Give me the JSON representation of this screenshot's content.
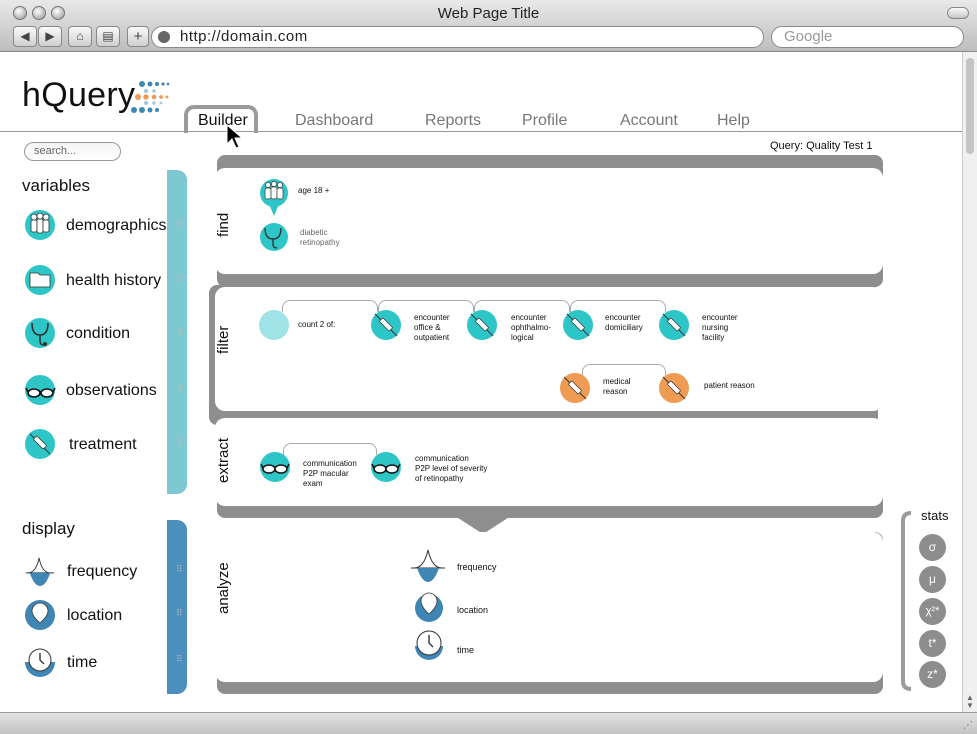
{
  "browser": {
    "title": "Web Page Title",
    "url": "http://domain.com",
    "search_placeholder": "Google"
  },
  "app": {
    "logo": "hQuery",
    "tabs": [
      "Builder",
      "Dashboard",
      "Reports",
      "Profile",
      "Account",
      "Help"
    ],
    "active_tab": "Builder",
    "search_placeholder": "search..."
  },
  "sidebar": {
    "variables_heading": "variables",
    "variables": [
      {
        "label": "demographics",
        "icon": "people-icon"
      },
      {
        "label": "health history",
        "icon": "folder-icon"
      },
      {
        "label": "condition",
        "icon": "stethoscope-icon"
      },
      {
        "label": "observations",
        "icon": "glasses-icon"
      },
      {
        "label": "treatment",
        "icon": "syringe-icon"
      }
    ],
    "display_heading": "display",
    "display": [
      {
        "label": "frequency",
        "icon": "bell-curve-icon"
      },
      {
        "label": "location",
        "icon": "location-pin-icon"
      },
      {
        "label": "time",
        "icon": "clock-icon"
      }
    ]
  },
  "query": {
    "label": "Query: Quality Test 1",
    "find": {
      "title": "find",
      "items": [
        {
          "text": "age 18 +",
          "icon": "people-icon"
        },
        {
          "line1": "diabetic",
          "line2": "retinopathy",
          "icon": "stethoscope-icon"
        }
      ]
    },
    "filter": {
      "title": "filter",
      "count_label": "count 2 of:",
      "encounters": [
        {
          "line1": "encounter",
          "line2": "office &",
          "line3": "outpatient"
        },
        {
          "line1": "encounter",
          "line2": "ophthalmo-",
          "line3": "logical"
        },
        {
          "line1": "encounter",
          "line2": "domiciliary",
          "line3": ""
        },
        {
          "line1": "encounter",
          "line2": "nursing",
          "line3": "facility"
        }
      ],
      "reasons": [
        {
          "line1": "medical",
          "line2": "reason"
        },
        {
          "line1": "patient reason",
          "line2": ""
        }
      ]
    },
    "extract": {
      "title": "extract",
      "items": [
        {
          "line1": "communication",
          "line2": "P2P macular",
          "line3": "exam"
        },
        {
          "line1": "communication",
          "line2": "P2P level of severity",
          "line3": "of retinopathy"
        }
      ]
    },
    "analyze": {
      "title": "analyze",
      "items": [
        "frequency",
        "location",
        "time"
      ]
    }
  },
  "stats": {
    "title": "stats",
    "buttons": [
      "σ",
      "μ",
      "χ²*",
      "t*",
      "z*"
    ]
  },
  "colors": {
    "teal": "#2ec5c7",
    "orange": "#ef9b53",
    "blue": "#3f86b4",
    "rail_variables": "#7cc9d1",
    "rail_display": "#4a8fbd"
  }
}
